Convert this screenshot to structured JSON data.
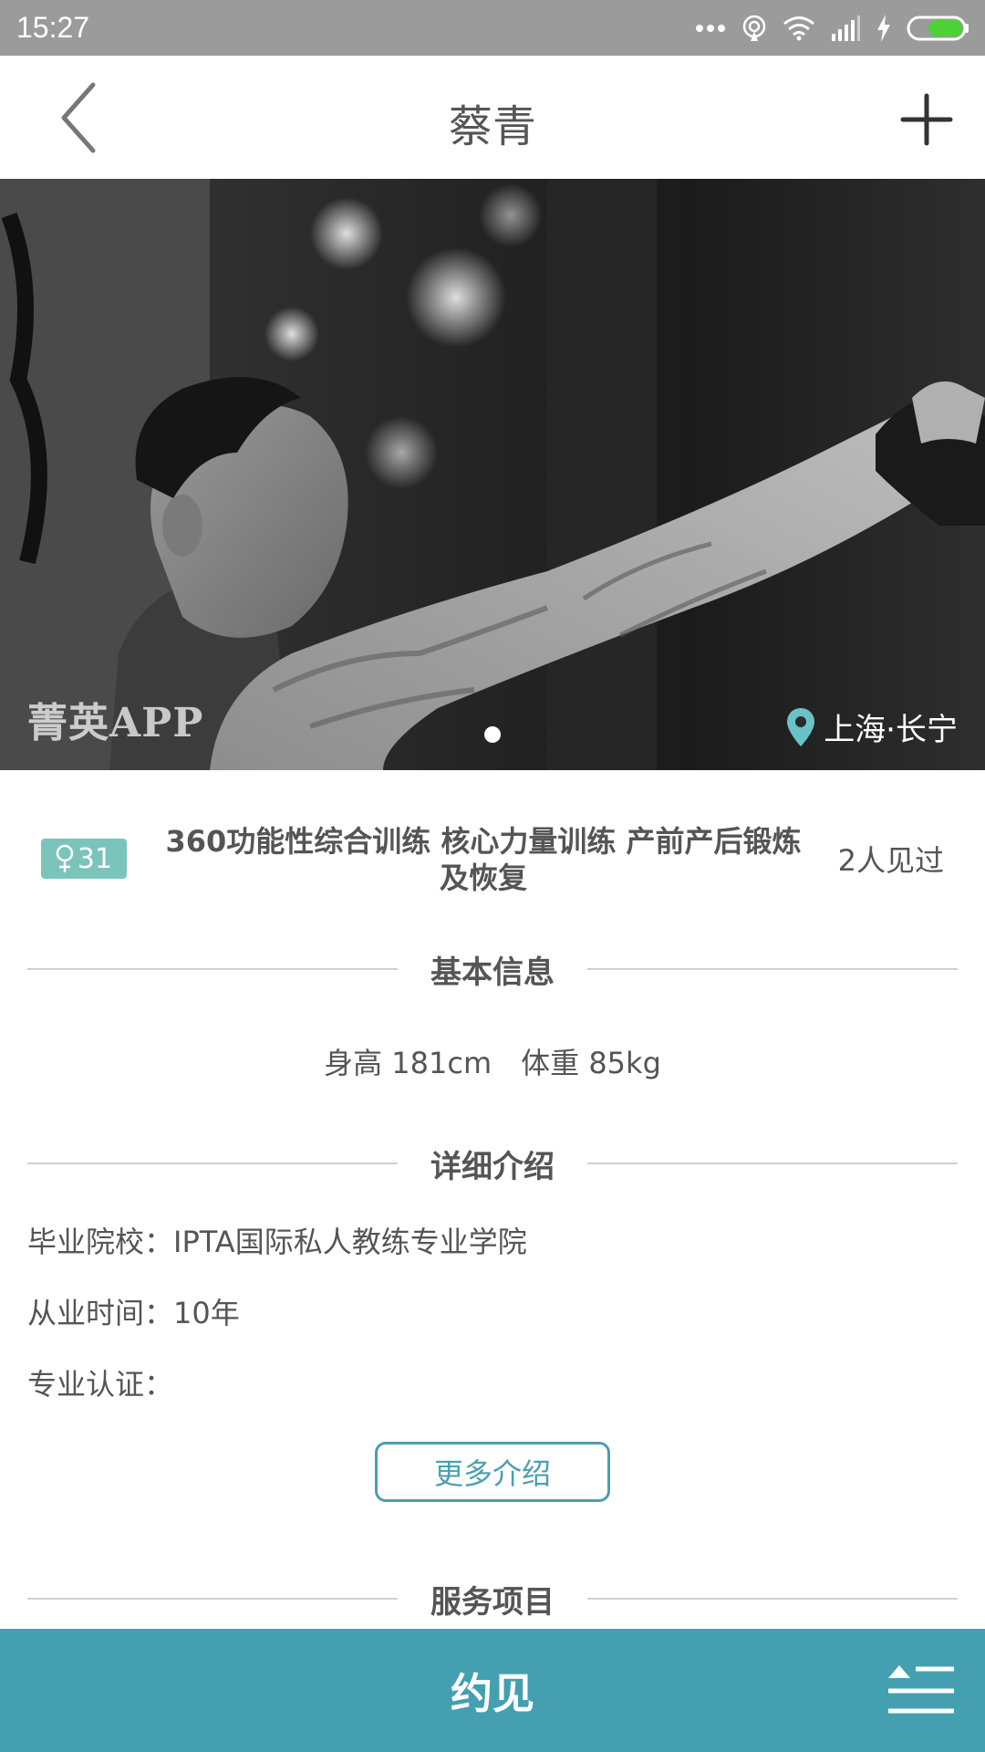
{
  "status_bar": {
    "time": "15:27",
    "icons": [
      "more-dots-icon",
      "hotspot-icon",
      "wifi-icon",
      "signal-icon",
      "charging-icon",
      "battery-icon"
    ]
  },
  "header": {
    "back_icon": "chevron-left-icon",
    "title": "蔡青",
    "add_icon": "plus-icon"
  },
  "hero": {
    "watermark": "菁英APP",
    "location": "上海·长宁",
    "carousel_index": 1,
    "carousel_total": 1
  },
  "profile": {
    "age_badge": "31",
    "gender_icon": "female-symbol-icon",
    "title": "360功能性综合训练 核心力量训练 产前产后锻炼及恢复",
    "seen_count": "2人见过"
  },
  "sections": {
    "basic": "基本信息",
    "detail": "详细介绍",
    "services": "服务项目"
  },
  "basic_info": {
    "height": "身高 181cm",
    "weight": "体重 85kg"
  },
  "detail": {
    "school": "毕业院校：IPTA国际私人教练专业学院",
    "years": "从业时间：10年",
    "cert": "专业认证："
  },
  "more_button": "更多介绍",
  "bottom_bar": {
    "appoint": "约见",
    "menu_icon": "menu-icon"
  },
  "colors": {
    "accent": "#44a0b1",
    "badge": "#7bc4bb",
    "status_bar": "#9b9b9b",
    "battery": "#4cd137"
  }
}
